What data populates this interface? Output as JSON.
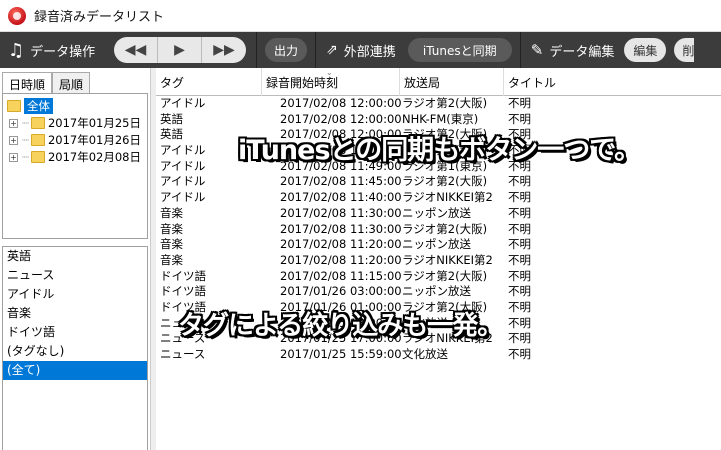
{
  "window": {
    "title": "録音済みデータリスト"
  },
  "toolbar": {
    "data_ops_label": "データ操作",
    "output_label": "出力",
    "external_label": "外部連携",
    "itunes_sync_label": "iTunesと同期",
    "data_edit_label": "データ編集",
    "edit_label": "編集",
    "delete_label": "削"
  },
  "left_tabs": {
    "date_tab": "日時順",
    "station_tab": "局順"
  },
  "tree": {
    "root": "全体",
    "dates": [
      "2017年01月25日",
      "2017年01月26日",
      "2017年02月08日"
    ]
  },
  "tags": [
    "英語",
    "ニュース",
    "アイドル",
    "音楽",
    "ドイツ語",
    "(タグなし)",
    "(全て)"
  ],
  "selected_tag": "(全て)",
  "columns": [
    "タグ",
    "録音開始時刻",
    "放送局",
    "タイトル"
  ],
  "rows": [
    [
      "アイドル",
      "2017/02/08 12:00:00",
      "ラジオ第2(大阪)",
      "不明"
    ],
    [
      "英語",
      "2017/02/08 12:00:00",
      "NHK-FM(東京)",
      "不明"
    ],
    [
      "英語",
      "2017/02/08 12:00:00",
      "ラジオ第2(大阪)",
      "不明"
    ],
    [
      "アイドル",
      "2017/02/08 12:00:00",
      "ラジオ第1(大阪)",
      "不明"
    ],
    [
      "アイドル",
      "2017/02/08 11:49:00",
      "ラジオ第1(東京)",
      "不明"
    ],
    [
      "アイドル",
      "2017/02/08 11:45:00",
      "ラジオ第2(大阪)",
      "不明"
    ],
    [
      "アイドル",
      "2017/02/08 11:40:00",
      "ラジオNIKKEI第2",
      "不明"
    ],
    [
      "音楽",
      "2017/02/08 11:30:00",
      "ニッポン放送",
      "不明"
    ],
    [
      "音楽",
      "2017/02/08 11:30:00",
      "ラジオ第2(大阪)",
      "不明"
    ],
    [
      "音楽",
      "2017/02/08 11:20:00",
      "ニッポン放送",
      "不明"
    ],
    [
      "音楽",
      "2017/02/08 11:20:00",
      "ラジオNIKKEI第2",
      "不明"
    ],
    [
      "ドイツ語",
      "2017/02/08 11:15:00",
      "ラジオ第2(大阪)",
      "不明"
    ],
    [
      "ドイツ語",
      "2017/01/26 03:00:00",
      "ニッポン放送",
      "不明"
    ],
    [
      "ドイツ語",
      "2017/01/26 01:00:00",
      "ラジオ第2(大阪)",
      "不明"
    ],
    [
      "ニュース",
      "2017/01/25 18:00:00",
      "文化放送",
      "不明"
    ],
    [
      "ニュース",
      "2017/01/25 17:00:00",
      "ラジオNIKKEI第2",
      "不明"
    ],
    [
      "ニュース",
      "2017/01/25 15:59:00",
      "文化放送",
      "不明"
    ]
  ],
  "captions": {
    "itunes": "iTunesとの同期もボタン一つで。",
    "tags": "タグによる絞り込みも一発。"
  }
}
